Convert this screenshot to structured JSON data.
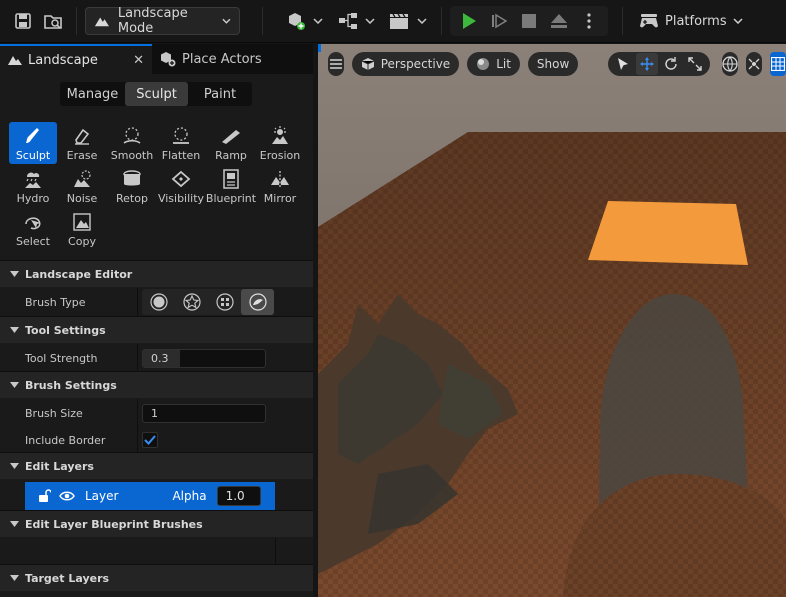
{
  "toolbar": {
    "mode_label": "Landscape Mode",
    "platforms_label": "Platforms"
  },
  "tabs": [
    {
      "label": "Landscape"
    },
    {
      "label": "Place Actors"
    }
  ],
  "modes": {
    "manage": "Manage",
    "sculpt": "Sculpt",
    "paint": "Paint",
    "selected": "Sculpt"
  },
  "tools": [
    {
      "label": "Sculpt",
      "icon": "sculpt-icon",
      "active": true
    },
    {
      "label": "Erase",
      "icon": "erase-icon"
    },
    {
      "label": "Smooth",
      "icon": "smooth-icon"
    },
    {
      "label": "Flatten",
      "icon": "flatten-icon"
    },
    {
      "label": "Ramp",
      "icon": "ramp-icon"
    },
    {
      "label": "Erosion",
      "icon": "erosion-icon"
    },
    {
      "label": "Hydro",
      "icon": "hydro-icon"
    },
    {
      "label": "Noise",
      "icon": "noise-icon"
    },
    {
      "label": "Retop",
      "icon": "retop-icon"
    },
    {
      "label": "Visibility",
      "icon": "visibility-icon"
    },
    {
      "label": "Blueprint",
      "icon": "blueprint-icon"
    },
    {
      "label": "Mirror",
      "icon": "mirror-icon"
    },
    {
      "label": "Select",
      "icon": "select-icon"
    },
    {
      "label": "Copy",
      "icon": "copy-icon"
    }
  ],
  "sections": {
    "landscape_editor": "Landscape Editor",
    "tool_settings": "Tool Settings",
    "brush_settings": "Brush Settings",
    "edit_layers": "Edit Layers",
    "edit_layer_bp": "Edit Layer Blueprint Brushes",
    "target_layers": "Target Layers"
  },
  "properties": {
    "brush_type_label": "Brush Type",
    "brush_type_selected": "alpha",
    "tool_strength_label": "Tool Strength",
    "tool_strength_value": "0.3",
    "tool_strength_fraction": 0.3,
    "brush_size_label": "Brush Size",
    "brush_size_value": "1",
    "include_border_label": "Include Border",
    "include_border_checked": true
  },
  "layer": {
    "name": "Layer",
    "alpha_label": "Alpha",
    "alpha_value": "1.0"
  },
  "viewport": {
    "perspective_label": "Perspective",
    "lit_label": "Lit",
    "show_label": "Show"
  },
  "colors": {
    "accent": "#0a66d0",
    "play_green": "#3cb83c",
    "ground": "#7b4a2c",
    "highlight_plane": "#f39a3c"
  }
}
